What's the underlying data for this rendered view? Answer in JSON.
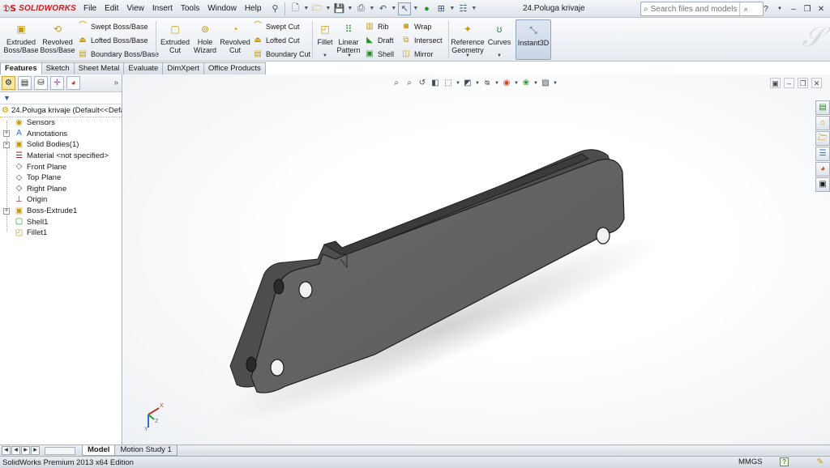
{
  "app": {
    "brand": "SOLIDWORKS",
    "document_title": "24.Poluga krivaje",
    "accent_color": "#d01c1c"
  },
  "menu": [
    "File",
    "Edit",
    "View",
    "Insert",
    "Tools",
    "Window",
    "Help"
  ],
  "search": {
    "placeholder": "Search files and models"
  },
  "ribbon": {
    "extruded_boss": "Extruded\nBoss/Base",
    "revolved_boss": "Revolved\nBoss/Base",
    "swept_boss": "Swept Boss/Base",
    "lofted_boss": "Lofted Boss/Base",
    "boundary_boss": "Boundary Boss/Base",
    "extruded_cut": "Extruded\nCut",
    "hole_wizard": "Hole\nWizard",
    "revolved_cut": "Revolved\nCut",
    "swept_cut": "Swept Cut",
    "lofted_cut": "Lofted Cut",
    "boundary_cut": "Boundary Cut",
    "fillet": "Fillet",
    "linear_pattern": "Linear\nPattern",
    "rib": "Rib",
    "draft": "Draft",
    "shell": "Shell",
    "wrap": "Wrap",
    "intersect": "Intersect",
    "mirror": "Mirror",
    "reference_geometry": "Reference\nGeometry",
    "curves": "Curves",
    "instant3d": "Instant3D"
  },
  "command_tabs": [
    {
      "label": "Features",
      "active": true
    },
    {
      "label": "Sketch",
      "active": false
    },
    {
      "label": "Sheet Metal",
      "active": false
    },
    {
      "label": "Evaluate",
      "active": false
    },
    {
      "label": "DimXpert",
      "active": false
    },
    {
      "label": "Office Products",
      "active": false
    }
  ],
  "feature_tree": {
    "root": "24.Poluga krivaje  (Default<<Defa",
    "items": [
      {
        "label": "Sensors",
        "icon": "sensor-icon",
        "expandable": false
      },
      {
        "label": "Annotations",
        "icon": "annotation-icon",
        "expandable": true
      },
      {
        "label": "Solid Bodies(1)",
        "icon": "solid-bodies-icon",
        "expandable": true
      },
      {
        "label": "Material <not specified>",
        "icon": "material-icon",
        "expandable": false
      },
      {
        "label": "Front Plane",
        "icon": "plane-icon",
        "expandable": false
      },
      {
        "label": "Top Plane",
        "icon": "plane-icon",
        "expandable": false
      },
      {
        "label": "Right Plane",
        "icon": "plane-icon",
        "expandable": false
      },
      {
        "label": "Origin",
        "icon": "origin-icon",
        "expandable": false
      },
      {
        "label": "Boss-Extrude1",
        "icon": "extrude-icon",
        "expandable": true
      },
      {
        "label": "Shell1",
        "icon": "shell-icon",
        "expandable": false
      },
      {
        "label": "Fillet1",
        "icon": "fillet-icon",
        "expandable": false
      }
    ]
  },
  "bottom_tabs": [
    {
      "label": "Model",
      "active": true
    },
    {
      "label": "Motion Study 1",
      "active": false
    }
  ],
  "status": {
    "edition": "SolidWorks Premium 2013 x64 Edition",
    "units": "MMGS",
    "help": "?"
  },
  "triad": {
    "x": "X",
    "y": "Y",
    "z": "Z"
  }
}
